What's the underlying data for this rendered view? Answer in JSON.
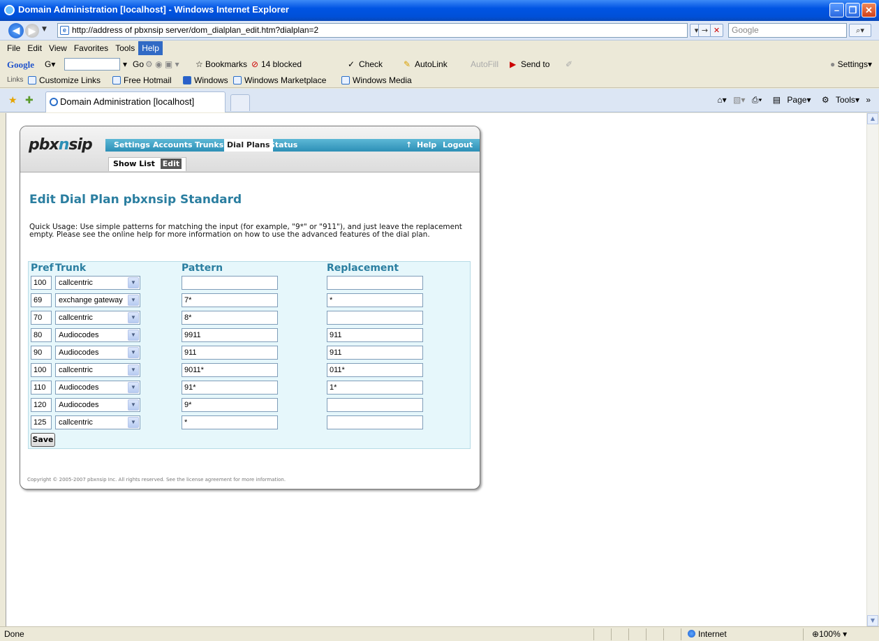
{
  "window": {
    "title": "Domain Administration [localhost] - Windows Internet Explorer"
  },
  "address": {
    "url": "http://address of pbxnsip server/dom_dialplan_edit.htm?dialplan=2",
    "search_placeholder": "Google"
  },
  "menu": [
    "File",
    "Edit",
    "View",
    "Favorites",
    "Tools",
    "Help"
  ],
  "google_toolbar": {
    "logo": "Google",
    "go": "Go",
    "bookmarks": "Bookmarks",
    "blocked": "14 blocked",
    "check": "Check",
    "autolink": "AutoLink",
    "autofill": "AutoFill",
    "sendto": "Send to",
    "settings": "Settings"
  },
  "links_bar": {
    "label": "Links",
    "items": [
      "Customize Links",
      "Free Hotmail",
      "Windows",
      "Windows Marketplace",
      "Windows Media"
    ]
  },
  "tab": {
    "title": "Domain Administration [localhost]",
    "tools": [
      "Page",
      "Tools"
    ]
  },
  "app": {
    "logo_a": "pbx",
    "logo_b": "n",
    "logo_c": "sip",
    "nav": [
      "Settings",
      "Accounts",
      "Trunks",
      "Dial Plans",
      "Status"
    ],
    "nav_right": [
      "Help",
      "Logout"
    ],
    "subnav": [
      "Show List",
      "Edit"
    ],
    "title": "Edit Dial Plan pbxnsip Standard",
    "usage": "Quick Usage: Use simple patterns for matching the input (for example, \"9*\" or \"911\"), and just leave the replacement empty. Please see the online help for more information on how to use the advanced features of the dial plan.",
    "headers": {
      "pref": "Pref",
      "trunk": "Trunk",
      "pattern": "Pattern",
      "replacement": "Replacement"
    },
    "rows": [
      {
        "pref": "100",
        "trunk": "callcentric",
        "pattern": "",
        "replacement": ""
      },
      {
        "pref": "69",
        "trunk": "exchange gateway",
        "pattern": "7*",
        "replacement": "*"
      },
      {
        "pref": "70",
        "trunk": "callcentric",
        "pattern": "8*",
        "replacement": ""
      },
      {
        "pref": "80",
        "trunk": "Audiocodes",
        "pattern": "9911",
        "replacement": "911"
      },
      {
        "pref": "90",
        "trunk": "Audiocodes",
        "pattern": "911",
        "replacement": "911"
      },
      {
        "pref": "100",
        "trunk": "callcentric",
        "pattern": "9011*",
        "replacement": "011*"
      },
      {
        "pref": "110",
        "trunk": "Audiocodes",
        "pattern": "91*",
        "replacement": "1*"
      },
      {
        "pref": "120",
        "trunk": "Audiocodes",
        "pattern": "9*",
        "replacement": ""
      },
      {
        "pref": "125",
        "trunk": "callcentric",
        "pattern": "*",
        "replacement": ""
      }
    ],
    "save_label": "Save",
    "copyright": "Copyright © 2005-2007 pbxnsip Inc. All rights reserved. See the license agreement for more information."
  },
  "status": {
    "text": "Done",
    "zone": "Internet",
    "zoom": "100%"
  }
}
